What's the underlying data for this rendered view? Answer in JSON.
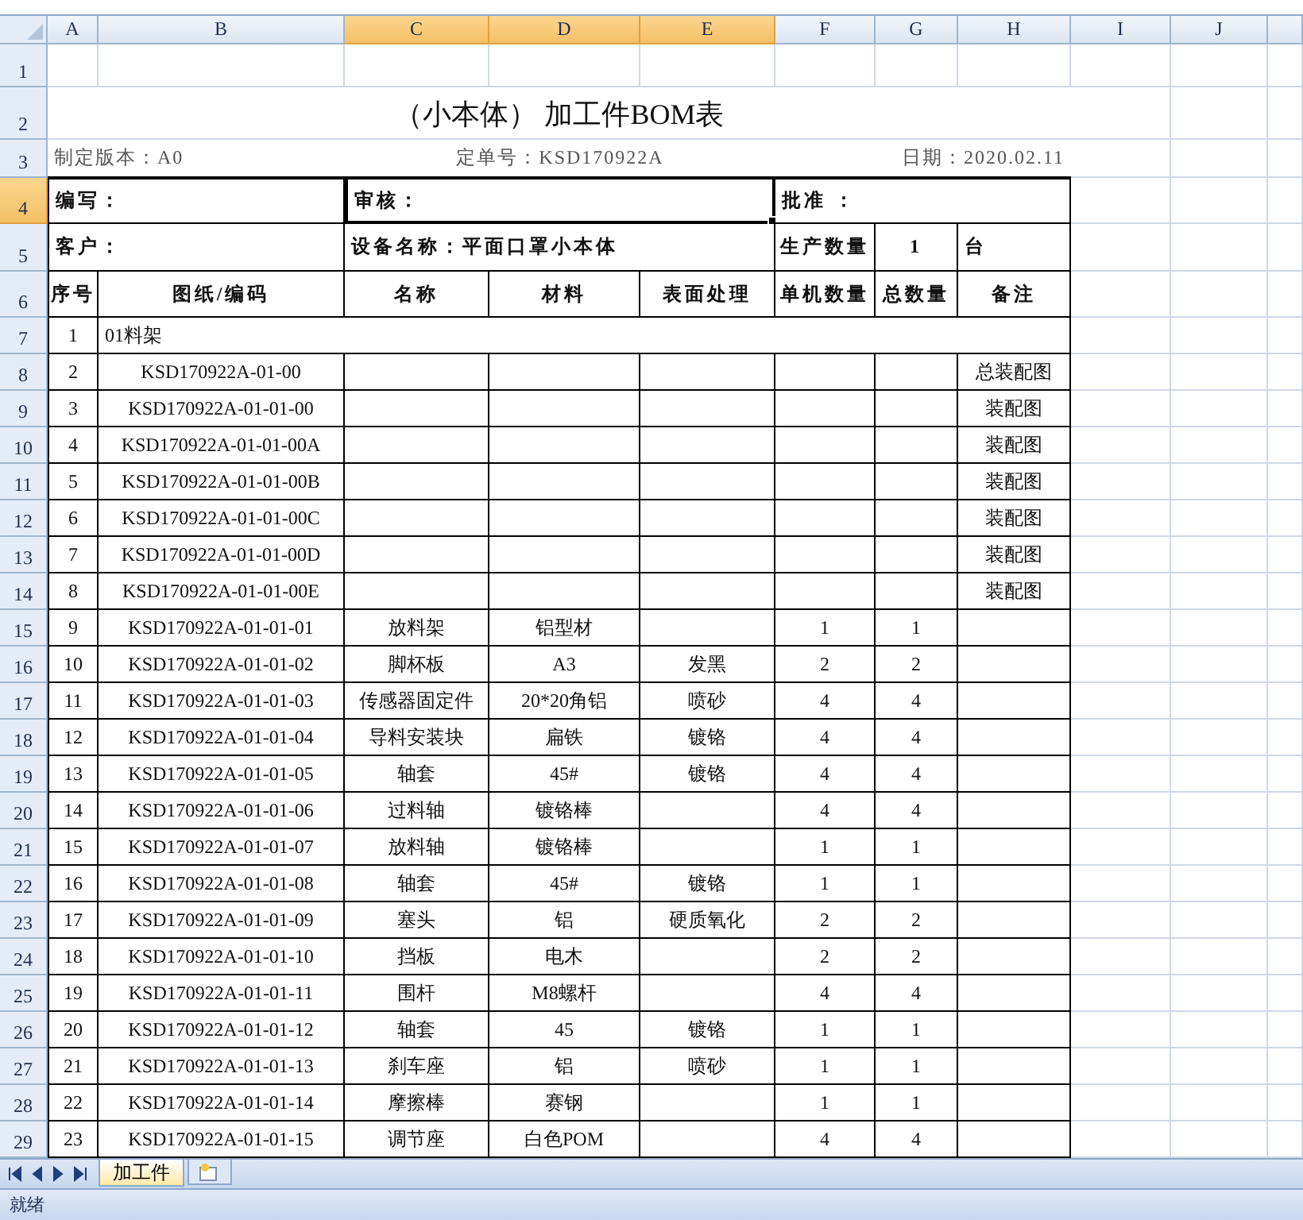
{
  "column_headers": [
    {
      "label": "A",
      "selected": false
    },
    {
      "label": "B",
      "selected": false
    },
    {
      "label": "C",
      "selected": true
    },
    {
      "label": "D",
      "selected": true
    },
    {
      "label": "E",
      "selected": true
    },
    {
      "label": "F",
      "selected": false
    },
    {
      "label": "G",
      "selected": false
    },
    {
      "label": "H",
      "selected": false
    },
    {
      "label": "I",
      "selected": false
    },
    {
      "label": "J",
      "selected": false
    }
  ],
  "row_headers": [
    {
      "label": "1",
      "selected": false
    },
    {
      "label": "2",
      "selected": false
    },
    {
      "label": "3",
      "selected": false
    },
    {
      "label": "4",
      "selected": true
    },
    {
      "label": "5",
      "selected": false
    },
    {
      "label": "6",
      "selected": false
    },
    {
      "label": "7",
      "selected": false
    },
    {
      "label": "8",
      "selected": false
    },
    {
      "label": "9",
      "selected": false
    },
    {
      "label": "10",
      "selected": false
    },
    {
      "label": "11",
      "selected": false
    },
    {
      "label": "12",
      "selected": false
    },
    {
      "label": "13",
      "selected": false
    },
    {
      "label": "14",
      "selected": false
    },
    {
      "label": "15",
      "selected": false
    },
    {
      "label": "16",
      "selected": false
    },
    {
      "label": "17",
      "selected": false
    },
    {
      "label": "18",
      "selected": false
    },
    {
      "label": "19",
      "selected": false
    },
    {
      "label": "20",
      "selected": false
    },
    {
      "label": "21",
      "selected": false
    },
    {
      "label": "22",
      "selected": false
    },
    {
      "label": "23",
      "selected": false
    },
    {
      "label": "24",
      "selected": false
    },
    {
      "label": "25",
      "selected": false
    },
    {
      "label": "26",
      "selected": false
    },
    {
      "label": "27",
      "selected": false
    },
    {
      "label": "28",
      "selected": false
    },
    {
      "label": "29",
      "selected": false
    }
  ],
  "title": "（小本体） 加工件BOM表",
  "info": {
    "version": "制定版本：A0",
    "order_no": "定单号：KSD170922A",
    "date": "日期：2020.02.11"
  },
  "form_cells": [
    {
      "text": "编写：",
      "selected": false
    },
    {
      "text": "审核：",
      "selected": true
    },
    {
      "text": "批准 ：",
      "selected": false
    },
    {
      "text": "客户：",
      "selected": false
    },
    {
      "text": "设备名称：平面口罩小本体",
      "selected": false
    },
    {
      "text": "生产数量",
      "selected": false
    },
    {
      "text": "1",
      "selected": false
    },
    {
      "text": "台",
      "selected": false
    }
  ],
  "table_headers": [
    "序号",
    "图纸/编码",
    "名称",
    "材料",
    "表面处理",
    "单机数量",
    "总数量",
    "备注"
  ],
  "bom_rows": [
    {
      "kind": "group",
      "no": "1",
      "label": "01料架"
    },
    {
      "kind": "part",
      "no": "2",
      "drawing_no": "KSD170922A-01-00",
      "remark": "总装配图"
    },
    {
      "kind": "part",
      "no": "3",
      "drawing_no": "KSD170922A-01-01-00",
      "remark": "装配图"
    },
    {
      "kind": "part",
      "no": "4",
      "drawing_no": "KSD170922A-01-01-00A",
      "remark": "装配图"
    },
    {
      "kind": "part",
      "no": "5",
      "drawing_no": "KSD170922A-01-01-00B",
      "remark": "装配图"
    },
    {
      "kind": "part",
      "no": "6",
      "drawing_no": "KSD170922A-01-01-00C",
      "remark": "装配图"
    },
    {
      "kind": "part",
      "no": "7",
      "drawing_no": "KSD170922A-01-01-00D",
      "remark": "装配图"
    },
    {
      "kind": "part",
      "no": "8",
      "drawing_no": "KSD170922A-01-01-00E",
      "remark": "装配图"
    },
    {
      "kind": "part",
      "no": "9",
      "drawing_no": "KSD170922A-01-01-01",
      "name": "放料架",
      "material": "铝型材",
      "unit_qty": "1",
      "total_qty": "1"
    },
    {
      "kind": "part",
      "no": "10",
      "drawing_no": "KSD170922A-01-01-02",
      "name": "脚杯板",
      "material": "A3",
      "surface_treatment": "发黑",
      "unit_qty": "2",
      "total_qty": "2"
    },
    {
      "kind": "part",
      "no": "11",
      "drawing_no": "KSD170922A-01-01-03",
      "name": "传感器固定件",
      "material": "20*20角铝",
      "surface_treatment": "喷砂",
      "unit_qty": "4",
      "total_qty": "4"
    },
    {
      "kind": "part",
      "no": "12",
      "drawing_no": "KSD170922A-01-01-04",
      "name": "导料安装块",
      "material": "扁铁",
      "surface_treatment": "镀铬",
      "unit_qty": "4",
      "total_qty": "4"
    },
    {
      "kind": "part",
      "no": "13",
      "drawing_no": "KSD170922A-01-01-05",
      "name": "轴套",
      "material": "45#",
      "surface_treatment": "镀铬",
      "unit_qty": "4",
      "total_qty": "4"
    },
    {
      "kind": "part",
      "no": "14",
      "drawing_no": "KSD170922A-01-01-06",
      "name": "过料轴",
      "material": "镀铬棒",
      "unit_qty": "4",
      "total_qty": "4"
    },
    {
      "kind": "part",
      "no": "15",
      "drawing_no": "KSD170922A-01-01-07",
      "name": "放料轴",
      "material": "镀铬棒",
      "unit_qty": "1",
      "total_qty": "1"
    },
    {
      "kind": "part",
      "no": "16",
      "drawing_no": "KSD170922A-01-01-08",
      "name": "轴套",
      "material": "45#",
      "surface_treatment": "镀铬",
      "unit_qty": "1",
      "total_qty": "1"
    },
    {
      "kind": "part",
      "no": "17",
      "drawing_no": "KSD170922A-01-01-09",
      "name": "塞头",
      "material": "铝",
      "surface_treatment": "硬质氧化",
      "unit_qty": "2",
      "total_qty": "2"
    },
    {
      "kind": "part",
      "no": "18",
      "drawing_no": "KSD170922A-01-01-10",
      "name": "挡板",
      "material": "电木",
      "unit_qty": "2",
      "total_qty": "2"
    },
    {
      "kind": "part",
      "no": "19",
      "drawing_no": "KSD170922A-01-01-11",
      "name": "围杆",
      "material": "M8螺杆",
      "unit_qty": "4",
      "total_qty": "4"
    },
    {
      "kind": "part",
      "no": "20",
      "drawing_no": "KSD170922A-01-01-12",
      "name": "轴套",
      "material": "45",
      "surface_treatment": "镀铬",
      "unit_qty": "1",
      "total_qty": "1"
    },
    {
      "kind": "part",
      "no": "21",
      "drawing_no": "KSD170922A-01-01-13",
      "name": "刹车座",
      "material": "铝",
      "surface_treatment": "喷砂",
      "unit_qty": "1",
      "total_qty": "1"
    },
    {
      "kind": "part",
      "no": "22",
      "drawing_no": "KSD170922A-01-01-14",
      "name": "摩擦棒",
      "material": "赛钢",
      "unit_qty": "1",
      "total_qty": "1"
    },
    {
      "kind": "part",
      "no": "23",
      "drawing_no": "KSD170922A-01-01-15",
      "name": "调节座",
      "material": "白色POM",
      "unit_qty": "4",
      "total_qty": "4"
    }
  ],
  "sheet_tabs": [
    {
      "label": "加工件",
      "selected": true
    }
  ],
  "status_bar": "就绪"
}
